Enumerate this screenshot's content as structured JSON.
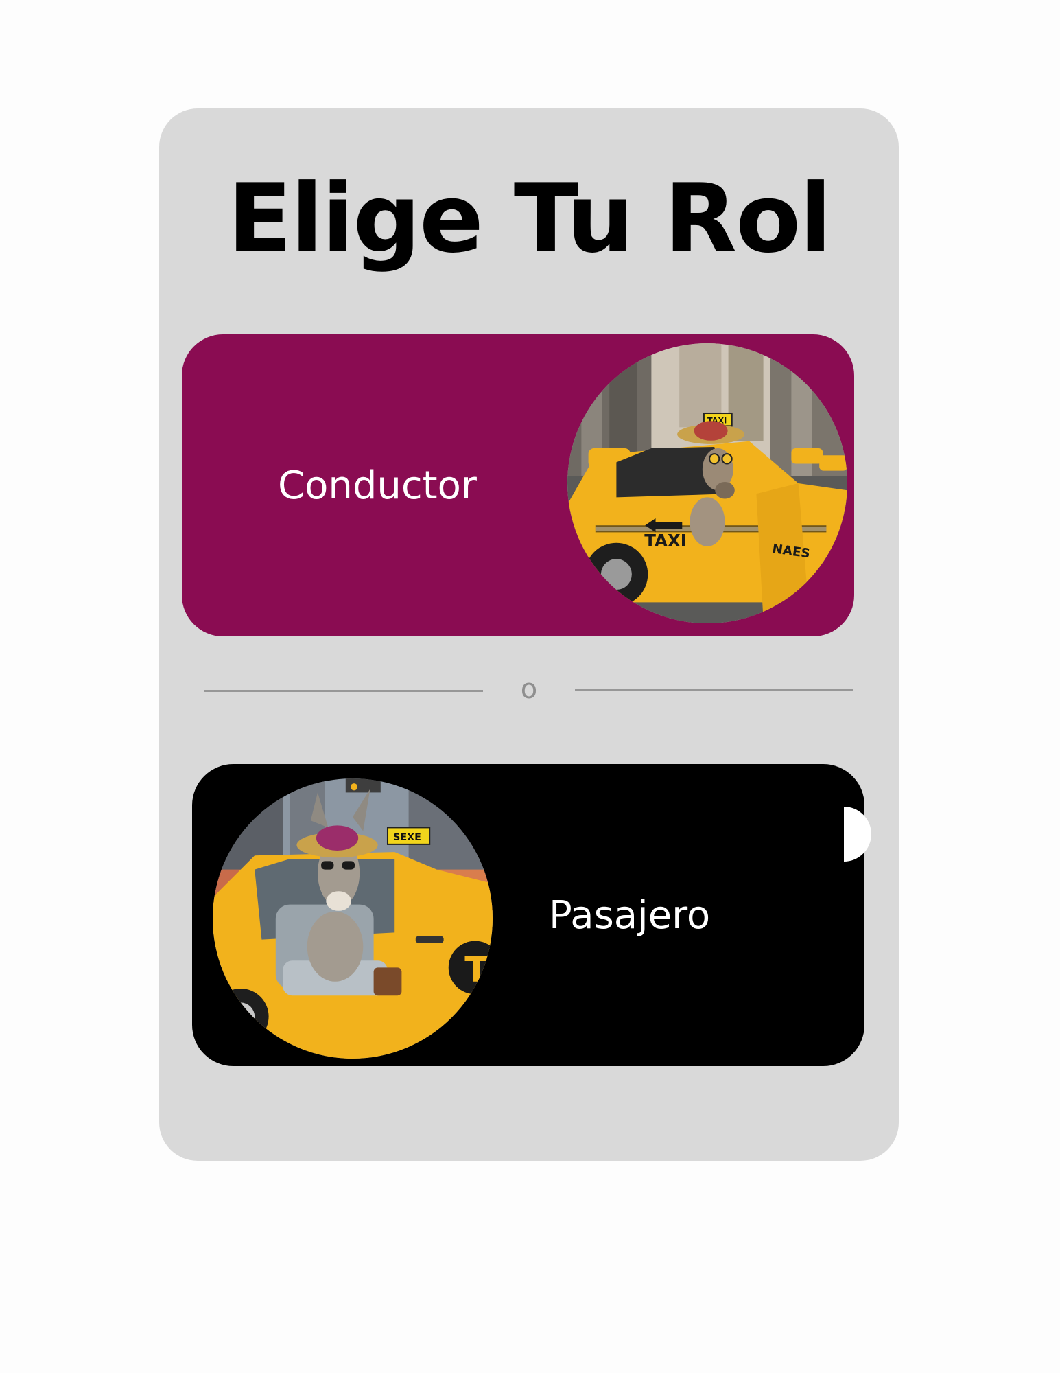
{
  "screen": {
    "title": "Elige Tu Rol",
    "divider_text": "o"
  },
  "roles": [
    {
      "label": "Conductor",
      "background": "#8a0c52",
      "image": "donkey-driving-taxi"
    },
    {
      "label": "Pasajero",
      "background": "#000000",
      "image": "donkey-riding-taxi"
    }
  ],
  "colors": {
    "page_background": "#fdfdfd",
    "panel_background": "#d9d9d9",
    "taxi_yellow": "#f2b21c",
    "divider": "#979797"
  }
}
